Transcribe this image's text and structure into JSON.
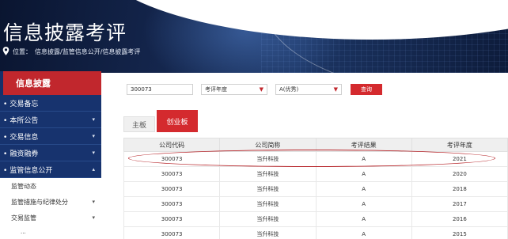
{
  "banner": {
    "title": "信息披露考评",
    "location_prefix": "位置：",
    "location_path": "信息披露/监管信息公开/信息披露考评"
  },
  "sidebar": {
    "heading": "信息披露",
    "items": [
      {
        "label": "交易备忘",
        "chevron": ""
      },
      {
        "label": "本所公告",
        "chevron": "▾"
      },
      {
        "label": "交易信息",
        "chevron": "▾"
      },
      {
        "label": "融资融券",
        "chevron": "▾"
      },
      {
        "label": "监管信息公开",
        "chevron": "▴"
      }
    ],
    "subitems": [
      {
        "label": "监管动态",
        "chevron": ""
      },
      {
        "label": "监管措施与纪律处分",
        "chevron": "▾"
      },
      {
        "label": "交易监管",
        "chevron": "▾"
      }
    ],
    "partial_subitem": "..."
  },
  "filters": {
    "code_value": "300073",
    "year_select": "考评年度",
    "result_select": "A(优秀)",
    "query_label": "查询"
  },
  "tabs": [
    {
      "label": "主板",
      "active": false
    },
    {
      "label": "创业板",
      "active": true
    }
  ],
  "table": {
    "headers": [
      "公司代码",
      "公司简称",
      "考评结果",
      "考评年度"
    ],
    "rows": [
      [
        "300073",
        "当升科技",
        "A",
        "2021"
      ],
      [
        "300073",
        "当升科技",
        "A",
        "2020"
      ],
      [
        "300073",
        "当升科技",
        "A",
        "2018"
      ],
      [
        "300073",
        "当升科技",
        "A",
        "2017"
      ],
      [
        "300073",
        "当升科技",
        "A",
        "2016"
      ],
      [
        "300073",
        "当升科技",
        "A",
        "2015"
      ]
    ]
  },
  "colors": {
    "accent_red": "#d42a2e",
    "sidebar_navy": "#17336e"
  }
}
